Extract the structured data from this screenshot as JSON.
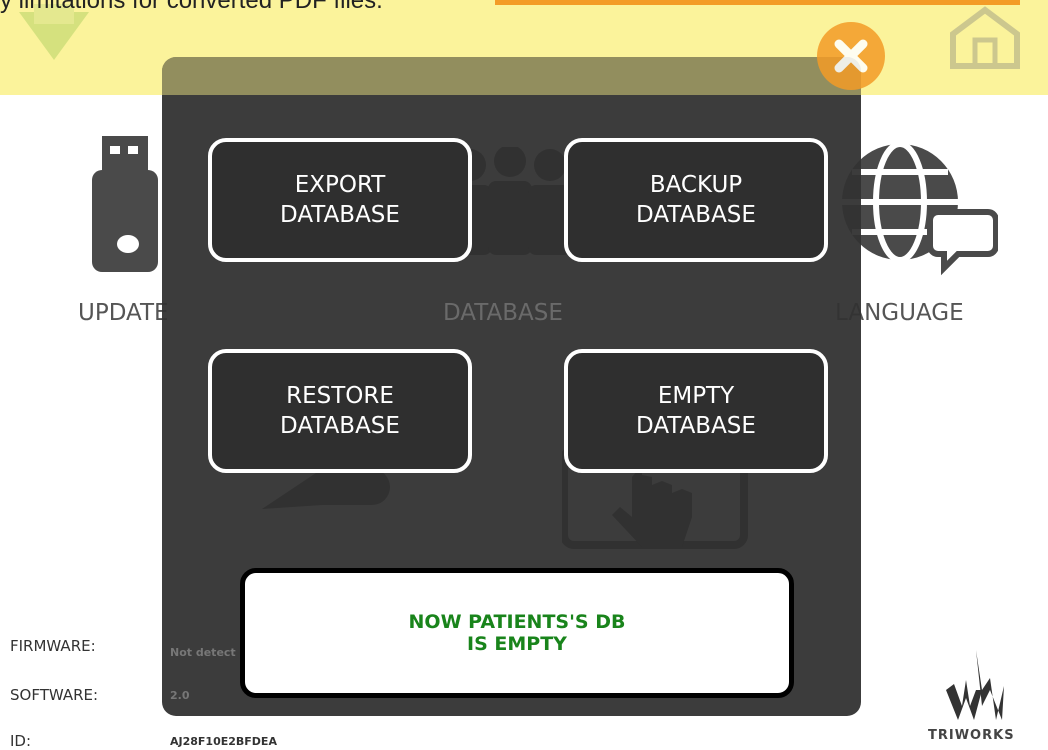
{
  "banner": {
    "notice": "y limitations for converted PDF files."
  },
  "tiles": {
    "update_label": "UPDATE",
    "database_label": "DATABASE",
    "language_label": "LANGUAGE"
  },
  "modal": {
    "buttons": [
      {
        "label": "EXPORT\nDATABASE"
      },
      {
        "label": "BACKUP\nDATABASE"
      },
      {
        "label": "RESTORE\nDATABASE"
      },
      {
        "label": "EMPTY\nDATABASE"
      }
    ],
    "result_message": "NOW PATIENTS'S DB\nIS EMPTY"
  },
  "info": {
    "firmware_label": "FIRMWARE:",
    "firmware_value": "Not detect",
    "software_label": "SOFTWARE:",
    "software_value": "2.0",
    "id_label": "ID:",
    "id_value": "AJ28F10E2BFDEA"
  },
  "brand": {
    "name": "TRIWORKS"
  },
  "colors": {
    "banner_bg": "#fbf39b",
    "accent_orange": "#f39c27",
    "modal_bg": "#323232",
    "success_green": "#19841b"
  },
  "icons": [
    "usb-drive-icon",
    "globe-chat-icon",
    "people-icon",
    "key-icon",
    "touch-hand-icon",
    "home-icon",
    "close-icon",
    "logo-icon",
    "triworks-logo-icon"
  ]
}
